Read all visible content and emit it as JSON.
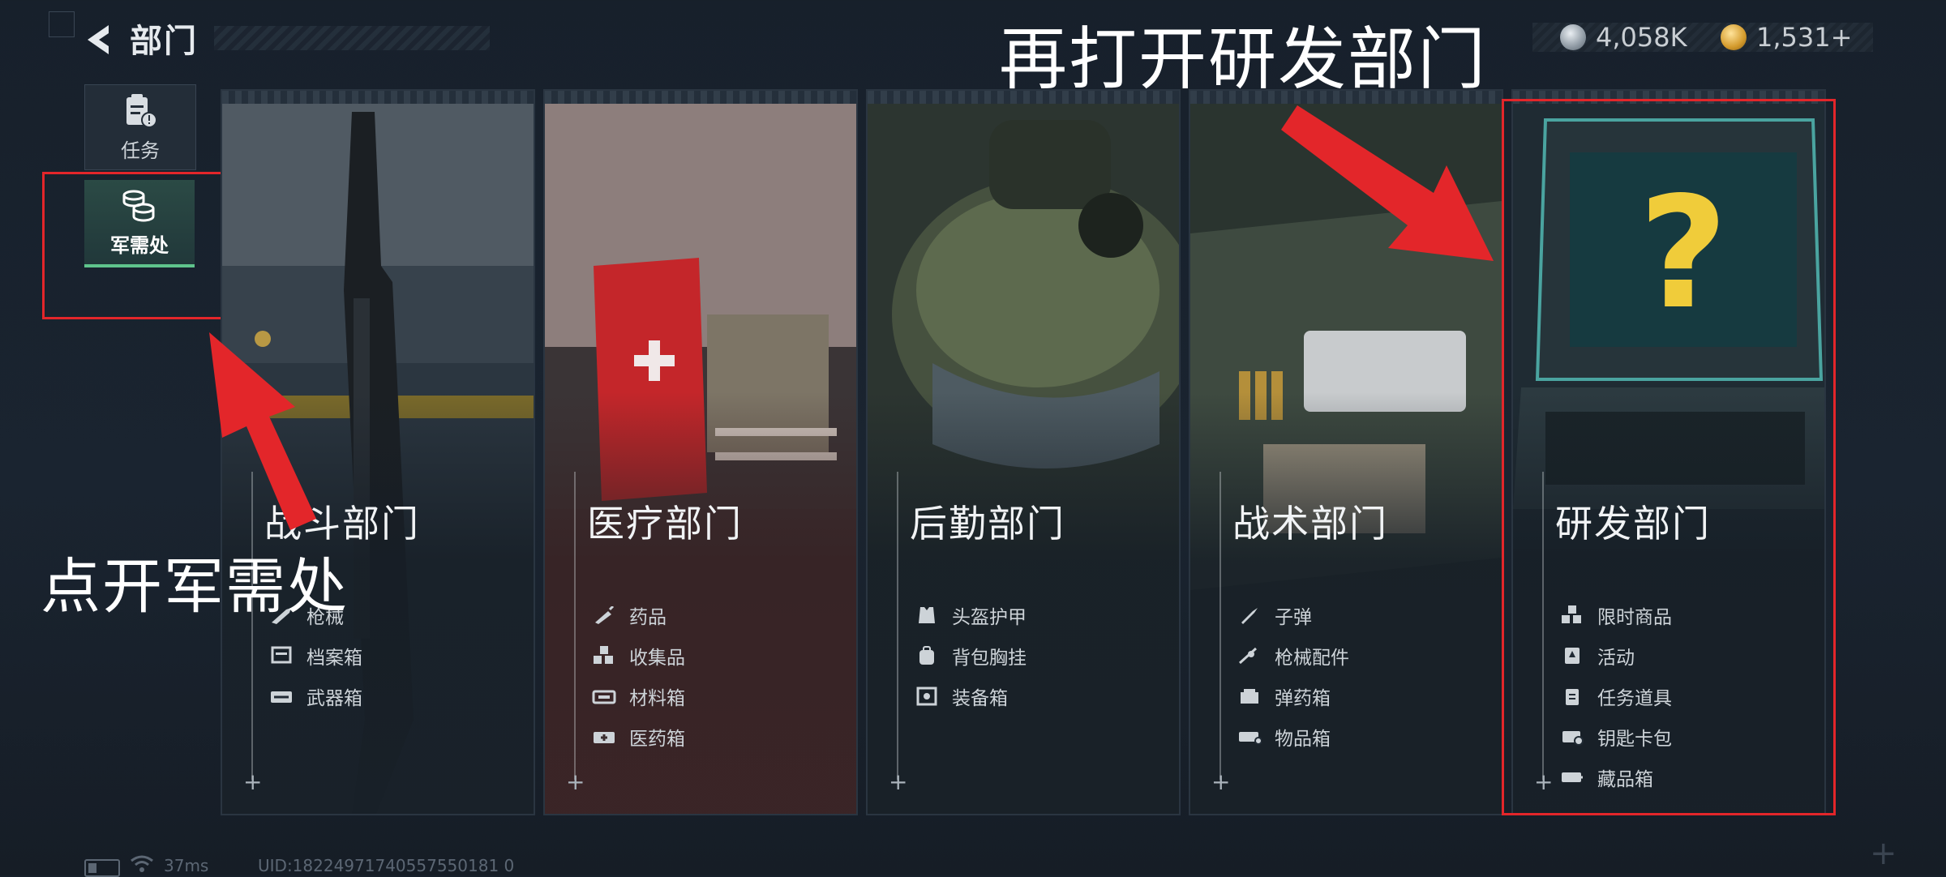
{
  "header": {
    "title": "部门",
    "currency": [
      {
        "icon": "silver-coin-icon",
        "value": "4,058K"
      },
      {
        "icon": "gold-coin-icon",
        "value": "1,531+"
      }
    ]
  },
  "sidebar": {
    "items": [
      {
        "label": "任务",
        "icon": "task-clipboard-icon",
        "selected": false
      },
      {
        "label": "军需处",
        "icon": "coin-stack-icon",
        "selected": true
      }
    ]
  },
  "annotations": {
    "top": "再打开研发部门",
    "left": "点开军需处"
  },
  "cards": [
    {
      "name": "战斗部门",
      "items": [
        {
          "label": "枪械",
          "icon": "rifle-icon"
        },
        {
          "label": "档案箱",
          "icon": "file-box-icon"
        },
        {
          "label": "武器箱",
          "icon": "weapon-case-icon"
        }
      ]
    },
    {
      "name": "医疗部门",
      "items": [
        {
          "label": "药品",
          "icon": "syringe-icon"
        },
        {
          "label": "收集品",
          "icon": "collectible-icon"
        },
        {
          "label": "材料箱",
          "icon": "material-case-icon"
        },
        {
          "label": "医药箱",
          "icon": "medical-case-icon"
        }
      ]
    },
    {
      "name": "后勤部门",
      "items": [
        {
          "label": "头盔护甲",
          "icon": "armor-icon"
        },
        {
          "label": "背包胸挂",
          "icon": "backpack-icon"
        },
        {
          "label": "装备箱",
          "icon": "gear-case-icon"
        }
      ]
    },
    {
      "name": "战术部门",
      "items": [
        {
          "label": "子弹",
          "icon": "bullet-icon"
        },
        {
          "label": "枪械配件",
          "icon": "attachment-icon"
        },
        {
          "label": "弹药箱",
          "icon": "ammo-case-icon"
        },
        {
          "label": "物品箱",
          "icon": "item-case-icon"
        }
      ]
    },
    {
      "name": "研发部门",
      "items": [
        {
          "label": "限时商品",
          "icon": "limited-goods-icon"
        },
        {
          "label": "活动",
          "icon": "event-icon"
        },
        {
          "label": "任务道具",
          "icon": "quest-item-icon"
        },
        {
          "label": "钥匙卡包",
          "icon": "keycard-icon"
        },
        {
          "label": "藏品箱",
          "icon": "collection-case-icon"
        }
      ]
    }
  ],
  "footer": {
    "ping": "37ms",
    "uid": "UID:18224971740557550181 0"
  },
  "colors": {
    "highlight_red": "#e3262a",
    "selected_green": "#5fc48c"
  }
}
